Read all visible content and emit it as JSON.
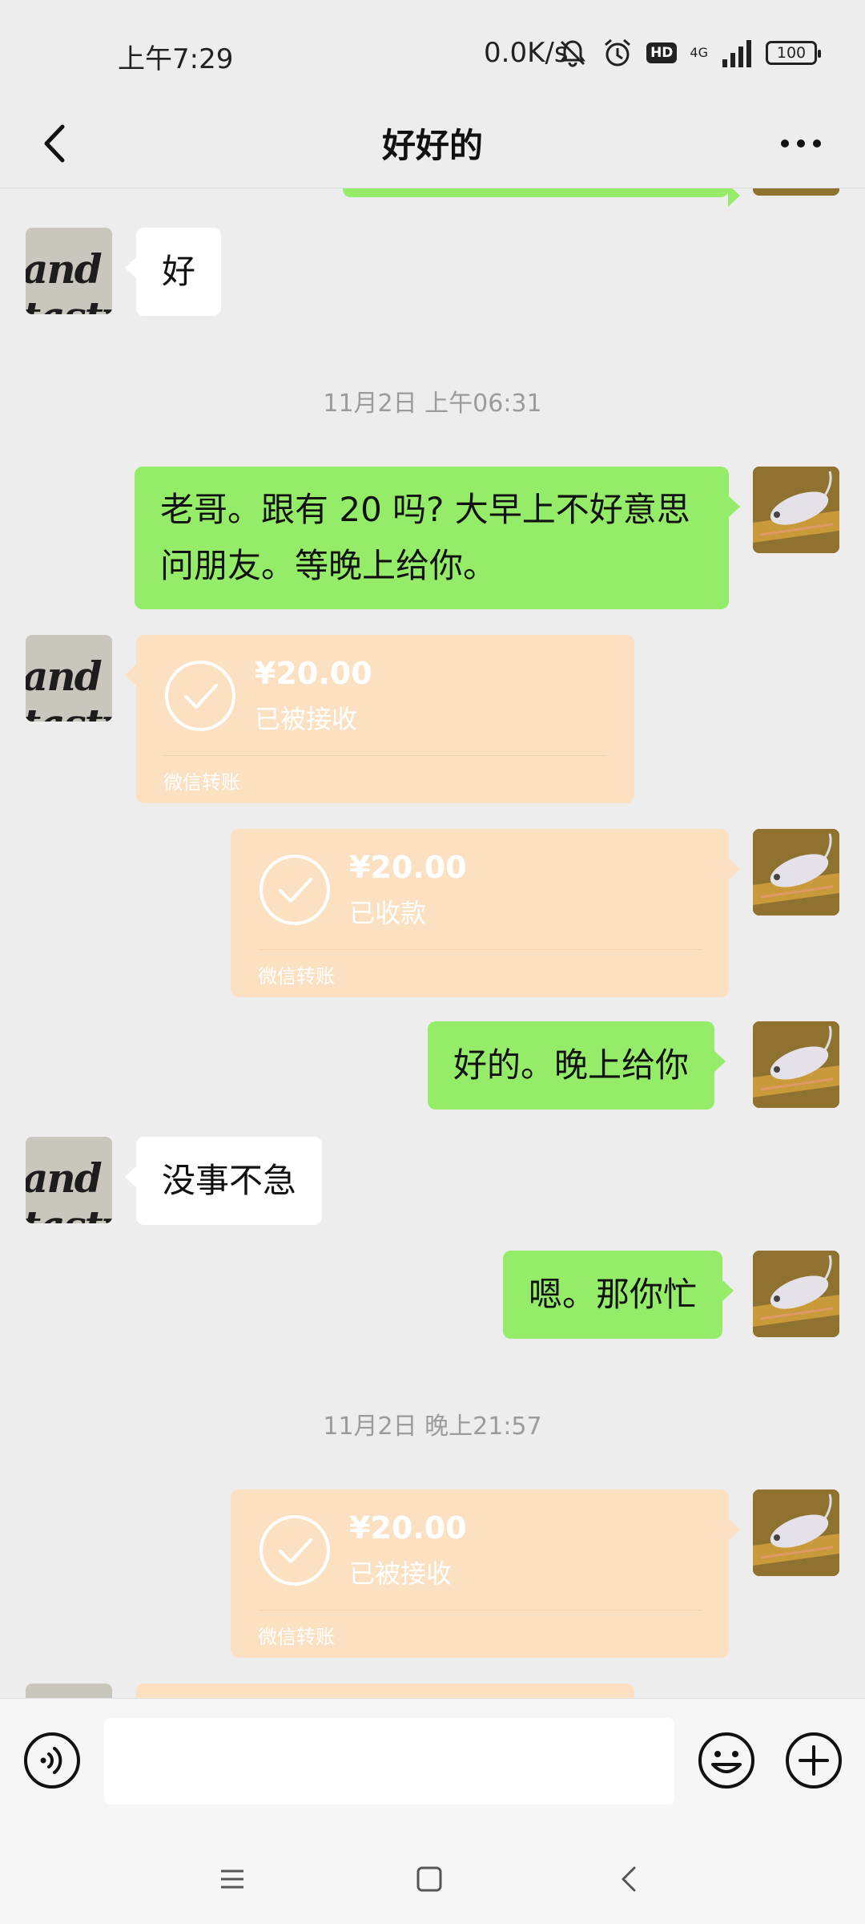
{
  "status_bar": {
    "time": "上午7:29",
    "net_speed": "0.0K/s",
    "hd": "HD",
    "network": "4G",
    "battery": "100"
  },
  "header": {
    "title": "好好的",
    "back_icon": "chevron-left-icon",
    "more_icon": "more-dots-icon"
  },
  "messages": [
    {
      "type": "text",
      "side": "left",
      "text": "好"
    },
    {
      "type": "time",
      "text": "11月2日 上午06:31"
    },
    {
      "type": "text",
      "side": "right",
      "lines": [
        "老哥。跟有 20 吗? 大早上不好意思",
        "问朋友。等晚上给你。"
      ]
    },
    {
      "type": "transfer",
      "side": "left",
      "amount": "¥20.00",
      "status": "已被接收",
      "label": "微信转账"
    },
    {
      "type": "transfer",
      "side": "right",
      "amount": "¥20.00",
      "status": "已收款",
      "label": "微信转账"
    },
    {
      "type": "text",
      "side": "right",
      "text": "好的。晚上给你"
    },
    {
      "type": "text",
      "side": "left",
      "text": "没事不急"
    },
    {
      "type": "text",
      "side": "right",
      "text": "嗯。那你忙"
    },
    {
      "type": "time",
      "text": "11月2日 晚上21:57"
    },
    {
      "type": "transfer",
      "side": "right",
      "amount": "¥20.00",
      "status": "已被接收",
      "label": "微信转账"
    }
  ],
  "contact_avatar_text": "and tasty",
  "input_bar": {
    "voice_icon": "voice-icon",
    "emoji_icon": "emoji-icon",
    "plus_icon": "plus-icon",
    "value": ""
  },
  "system_nav": [
    "menu-icon",
    "home-icon",
    "back-icon"
  ],
  "colors": {
    "background": "#ededed",
    "my_bubble": "#95ec69",
    "their_bubble": "#ffffff",
    "transfer_bubble": "#fce0c2"
  }
}
